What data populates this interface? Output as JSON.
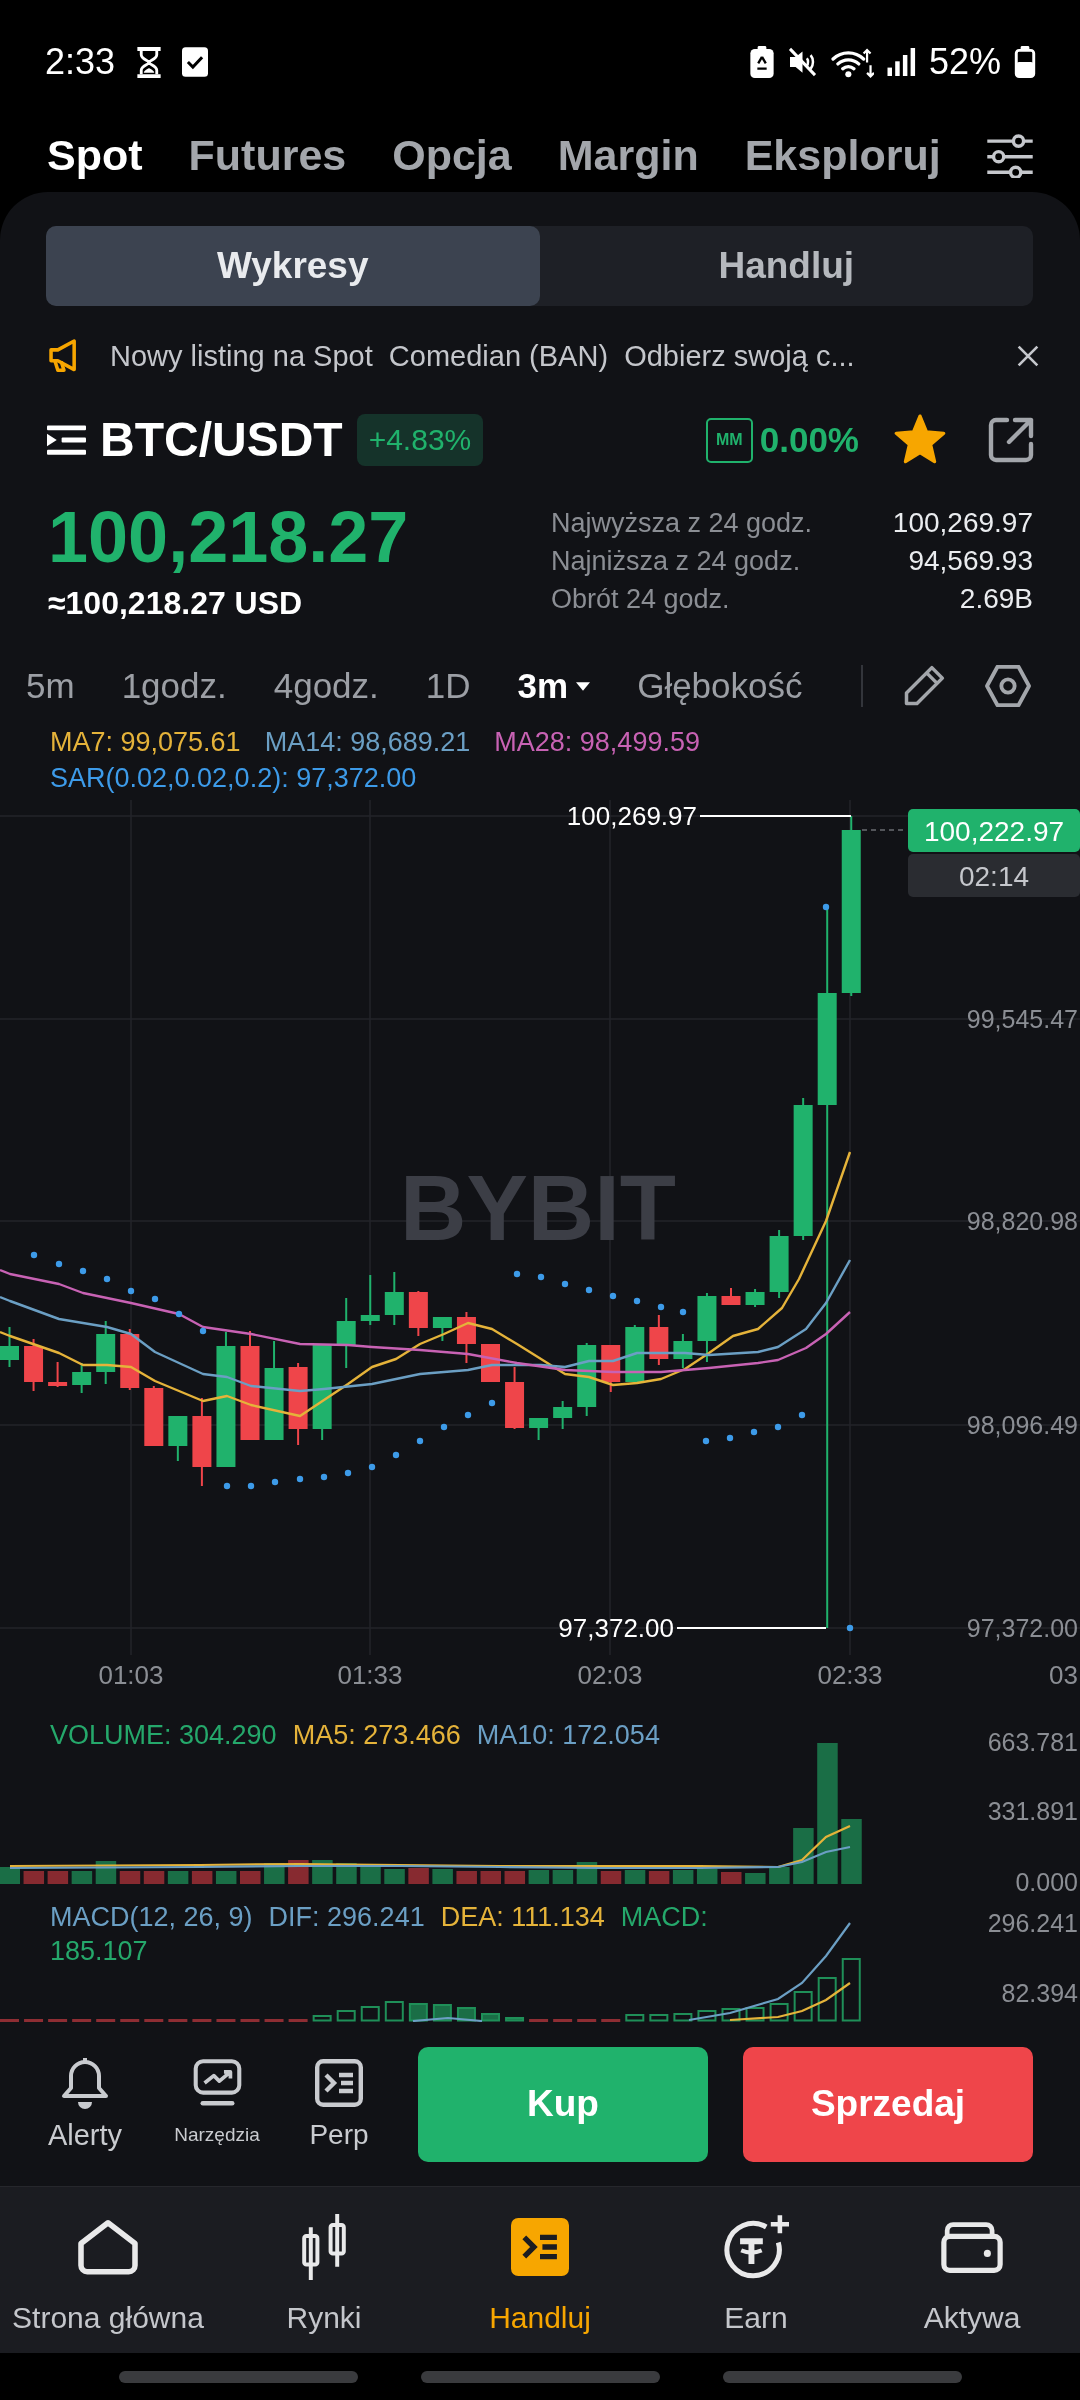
{
  "status_bar": {
    "time": "2:33",
    "battery": "52%"
  },
  "top_tabs": [
    {
      "label": "Spot",
      "selected": true
    },
    {
      "label": "Futures",
      "selected": false
    },
    {
      "label": "Opcja",
      "selected": false
    },
    {
      "label": "Margin",
      "selected": false
    },
    {
      "label": "Eksploruj",
      "selected": false
    }
  ],
  "view_tabs": [
    {
      "label": "Wykresy",
      "selected": true
    },
    {
      "label": "Handluj",
      "selected": false
    }
  ],
  "announcement": "Nowy listing na Spot  Comedian (BAN)  Odbierz swoją c...",
  "pair": {
    "symbol": "BTC/USDT",
    "change": "+4.83%",
    "mm_label": "MM",
    "mm_rate": "0.00%",
    "favorite": true
  },
  "price": {
    "last": "100,218.27",
    "usd": "≈100,218.27 USD"
  },
  "stats": [
    {
      "label": "Najwyższa z 24 godz.",
      "value": "100,269.97"
    },
    {
      "label": "Najniższa z 24 godz.",
      "value": "94,569.93"
    },
    {
      "label": "Obrót 24 godz.",
      "value": "2.69B"
    }
  ],
  "timeframes": [
    {
      "label": "5m",
      "selected": false,
      "dropdown": false
    },
    {
      "label": "1godz.",
      "selected": false,
      "dropdown": false
    },
    {
      "label": "4godz.",
      "selected": false,
      "dropdown": false
    },
    {
      "label": "1D",
      "selected": false,
      "dropdown": false
    },
    {
      "label": "3m",
      "selected": true,
      "dropdown": true
    },
    {
      "label": "Głębokość",
      "selected": false,
      "dropdown": false
    }
  ],
  "chart_legend": [
    {
      "text": "MA7: 99,075.61",
      "color": "#e5b33a"
    },
    {
      "text": "MA14: 98,689.21",
      "color": "#6b9fc4"
    },
    {
      "text": "MA28: 98,499.59",
      "color": "#c862b4"
    },
    {
      "text": "SAR(0.02,0.02,0.2): 97,372.00",
      "color": "#3d9be9"
    }
  ],
  "chart": {
    "watermark": "BYBIT",
    "high_marker": "100,269.97",
    "low_marker": "97,372.00",
    "last_price": "100,222.97",
    "countdown": "02:14",
    "price_axis": [
      "99,545.47",
      "98,820.98",
      "98,096.49",
      "97,372.00"
    ],
    "time_axis": [
      "01:03",
      "01:33",
      "02:03",
      "02:33",
      "03"
    ]
  },
  "volume": {
    "legend": [
      {
        "text": "VOLUME: 304.290",
        "color": "#25a86b"
      },
      {
        "text": "MA5: 273.466",
        "color": "#e5b33a"
      },
      {
        "text": "MA10: 172.054",
        "color": "#6b9fc4"
      }
    ],
    "axis": [
      "663.781",
      "331.891",
      "0.000"
    ]
  },
  "macd": {
    "legend": [
      {
        "text": "MACD(12, 26, 9)",
        "color": "#6b9fc4"
      },
      {
        "text": "DIF: 296.241",
        "color": "#6b9fc4"
      },
      {
        "text": "DEA: 111.134",
        "color": "#e5b33a"
      },
      {
        "text": "MACD:",
        "color": "#25a86b"
      },
      {
        "text": "185.107",
        "color": "#25a86b"
      }
    ],
    "axis": [
      "296.241",
      "82.394"
    ]
  },
  "tools": [
    {
      "label": "Alerty"
    },
    {
      "label": "Narzędzia"
    },
    {
      "label": "Perp"
    }
  ],
  "trade_buttons": [
    {
      "label": "Kup",
      "kind": "buy"
    },
    {
      "label": "Sprzedaj",
      "kind": "sell"
    }
  ],
  "bottom_nav": [
    {
      "label": "Strona główna",
      "selected": false
    },
    {
      "label": "Rynki",
      "selected": false
    },
    {
      "label": "Handluj",
      "selected": true
    },
    {
      "label": "Earn",
      "selected": false
    },
    {
      "label": "Aktywa",
      "selected": false
    }
  ]
}
